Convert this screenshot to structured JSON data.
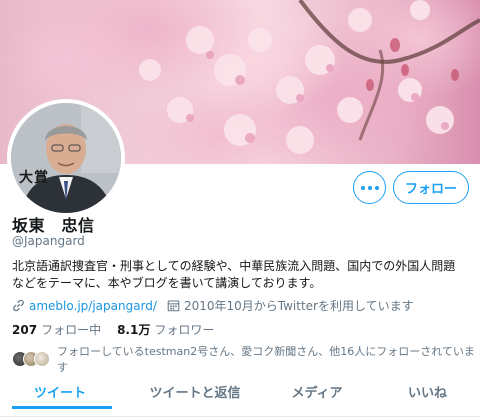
{
  "banner": {
    "alt": "cherry blossoms"
  },
  "avatar": {
    "badge_text": "大賞"
  },
  "actions": {
    "more_icon": "more-horizontal-icon",
    "follow_label": "フォロー"
  },
  "profile": {
    "display_name": "坂東　忠信",
    "handle": "@Japangard",
    "bio_lines": [
      "北京語通訳捜査官・刑事としての経験や、中華民族流入問題、国内での外国人問題",
      "などをテーマに、本やブログを書いて講演しております。"
    ]
  },
  "meta": {
    "link_icon": "link-icon",
    "link_text": "ameblo.jp/japangard/",
    "calendar_icon": "calendar-icon",
    "joined_text": "2010年10月からTwitterを利用しています"
  },
  "counts": {
    "following_value": "207",
    "following_label": "フォロー中",
    "followers_value": "8.1万",
    "followers_label": "フォロワー"
  },
  "followed_by": {
    "text": "フォローしているtestman2号さん、愛コク新聞さん、他16人にフォローされています"
  },
  "tabs": [
    {
      "label": "ツイート",
      "active": true
    },
    {
      "label": "ツイートと返信",
      "active": false
    },
    {
      "label": "メディア",
      "active": false
    },
    {
      "label": "いいね",
      "active": false
    }
  ],
  "colors": {
    "accent": "#1da1f2",
    "link": "#1b95e0",
    "muted": "#657786"
  }
}
